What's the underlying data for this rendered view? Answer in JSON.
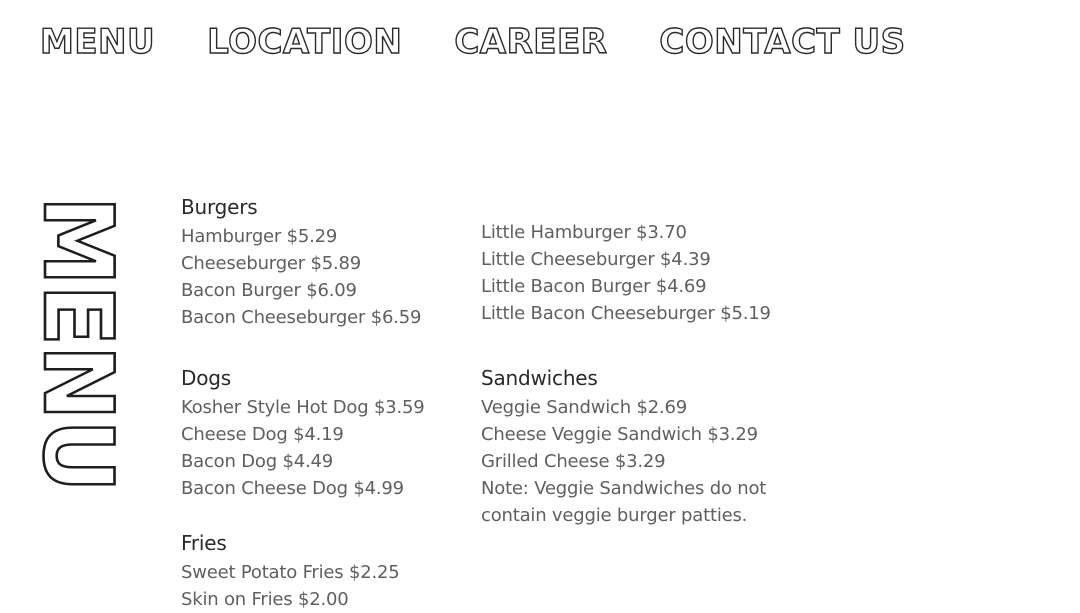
{
  "nav": {
    "items": [
      "MENU",
      "LOCATION",
      "CAREER",
      "CONTACT US"
    ]
  },
  "page_title": "MENU",
  "sections": {
    "burgers": {
      "title": "Burgers",
      "items": [
        "Hamburger $5.29",
        "Cheeseburger $5.89",
        "Bacon Burger $6.09",
        "Bacon Cheeseburger $6.59"
      ]
    },
    "little_burgers": {
      "items": [
        "Little Hamburger $3.70",
        "Little Cheeseburger $4.39",
        "Little Bacon Burger $4.69",
        "Little Bacon Cheeseburger $5.19"
      ]
    },
    "dogs": {
      "title": "Dogs",
      "items": [
        "Kosher Style Hot Dog $3.59",
        "Cheese Dog $4.19",
        "Bacon Dog $4.49",
        "Bacon Cheese Dog $4.99"
      ]
    },
    "sandwiches": {
      "title": "Sandwiches",
      "items": [
        "Veggie Sandwich $2.69",
        "Cheese Veggie Sandwich $3.29",
        "Grilled Cheese $3.29"
      ],
      "note": "Note: Veggie Sandwiches do not contain veggie burger patties."
    },
    "fries": {
      "title": "Fries",
      "items": [
        "Sweet Potato Fries $2.25",
        "Skin on Fries $2.00"
      ]
    }
  },
  "colors": {
    "background": "#ffffff",
    "heading_text": "#2a2a2a",
    "item_text": "#5f5f5f",
    "outline_stroke": "#1e1e1e"
  }
}
